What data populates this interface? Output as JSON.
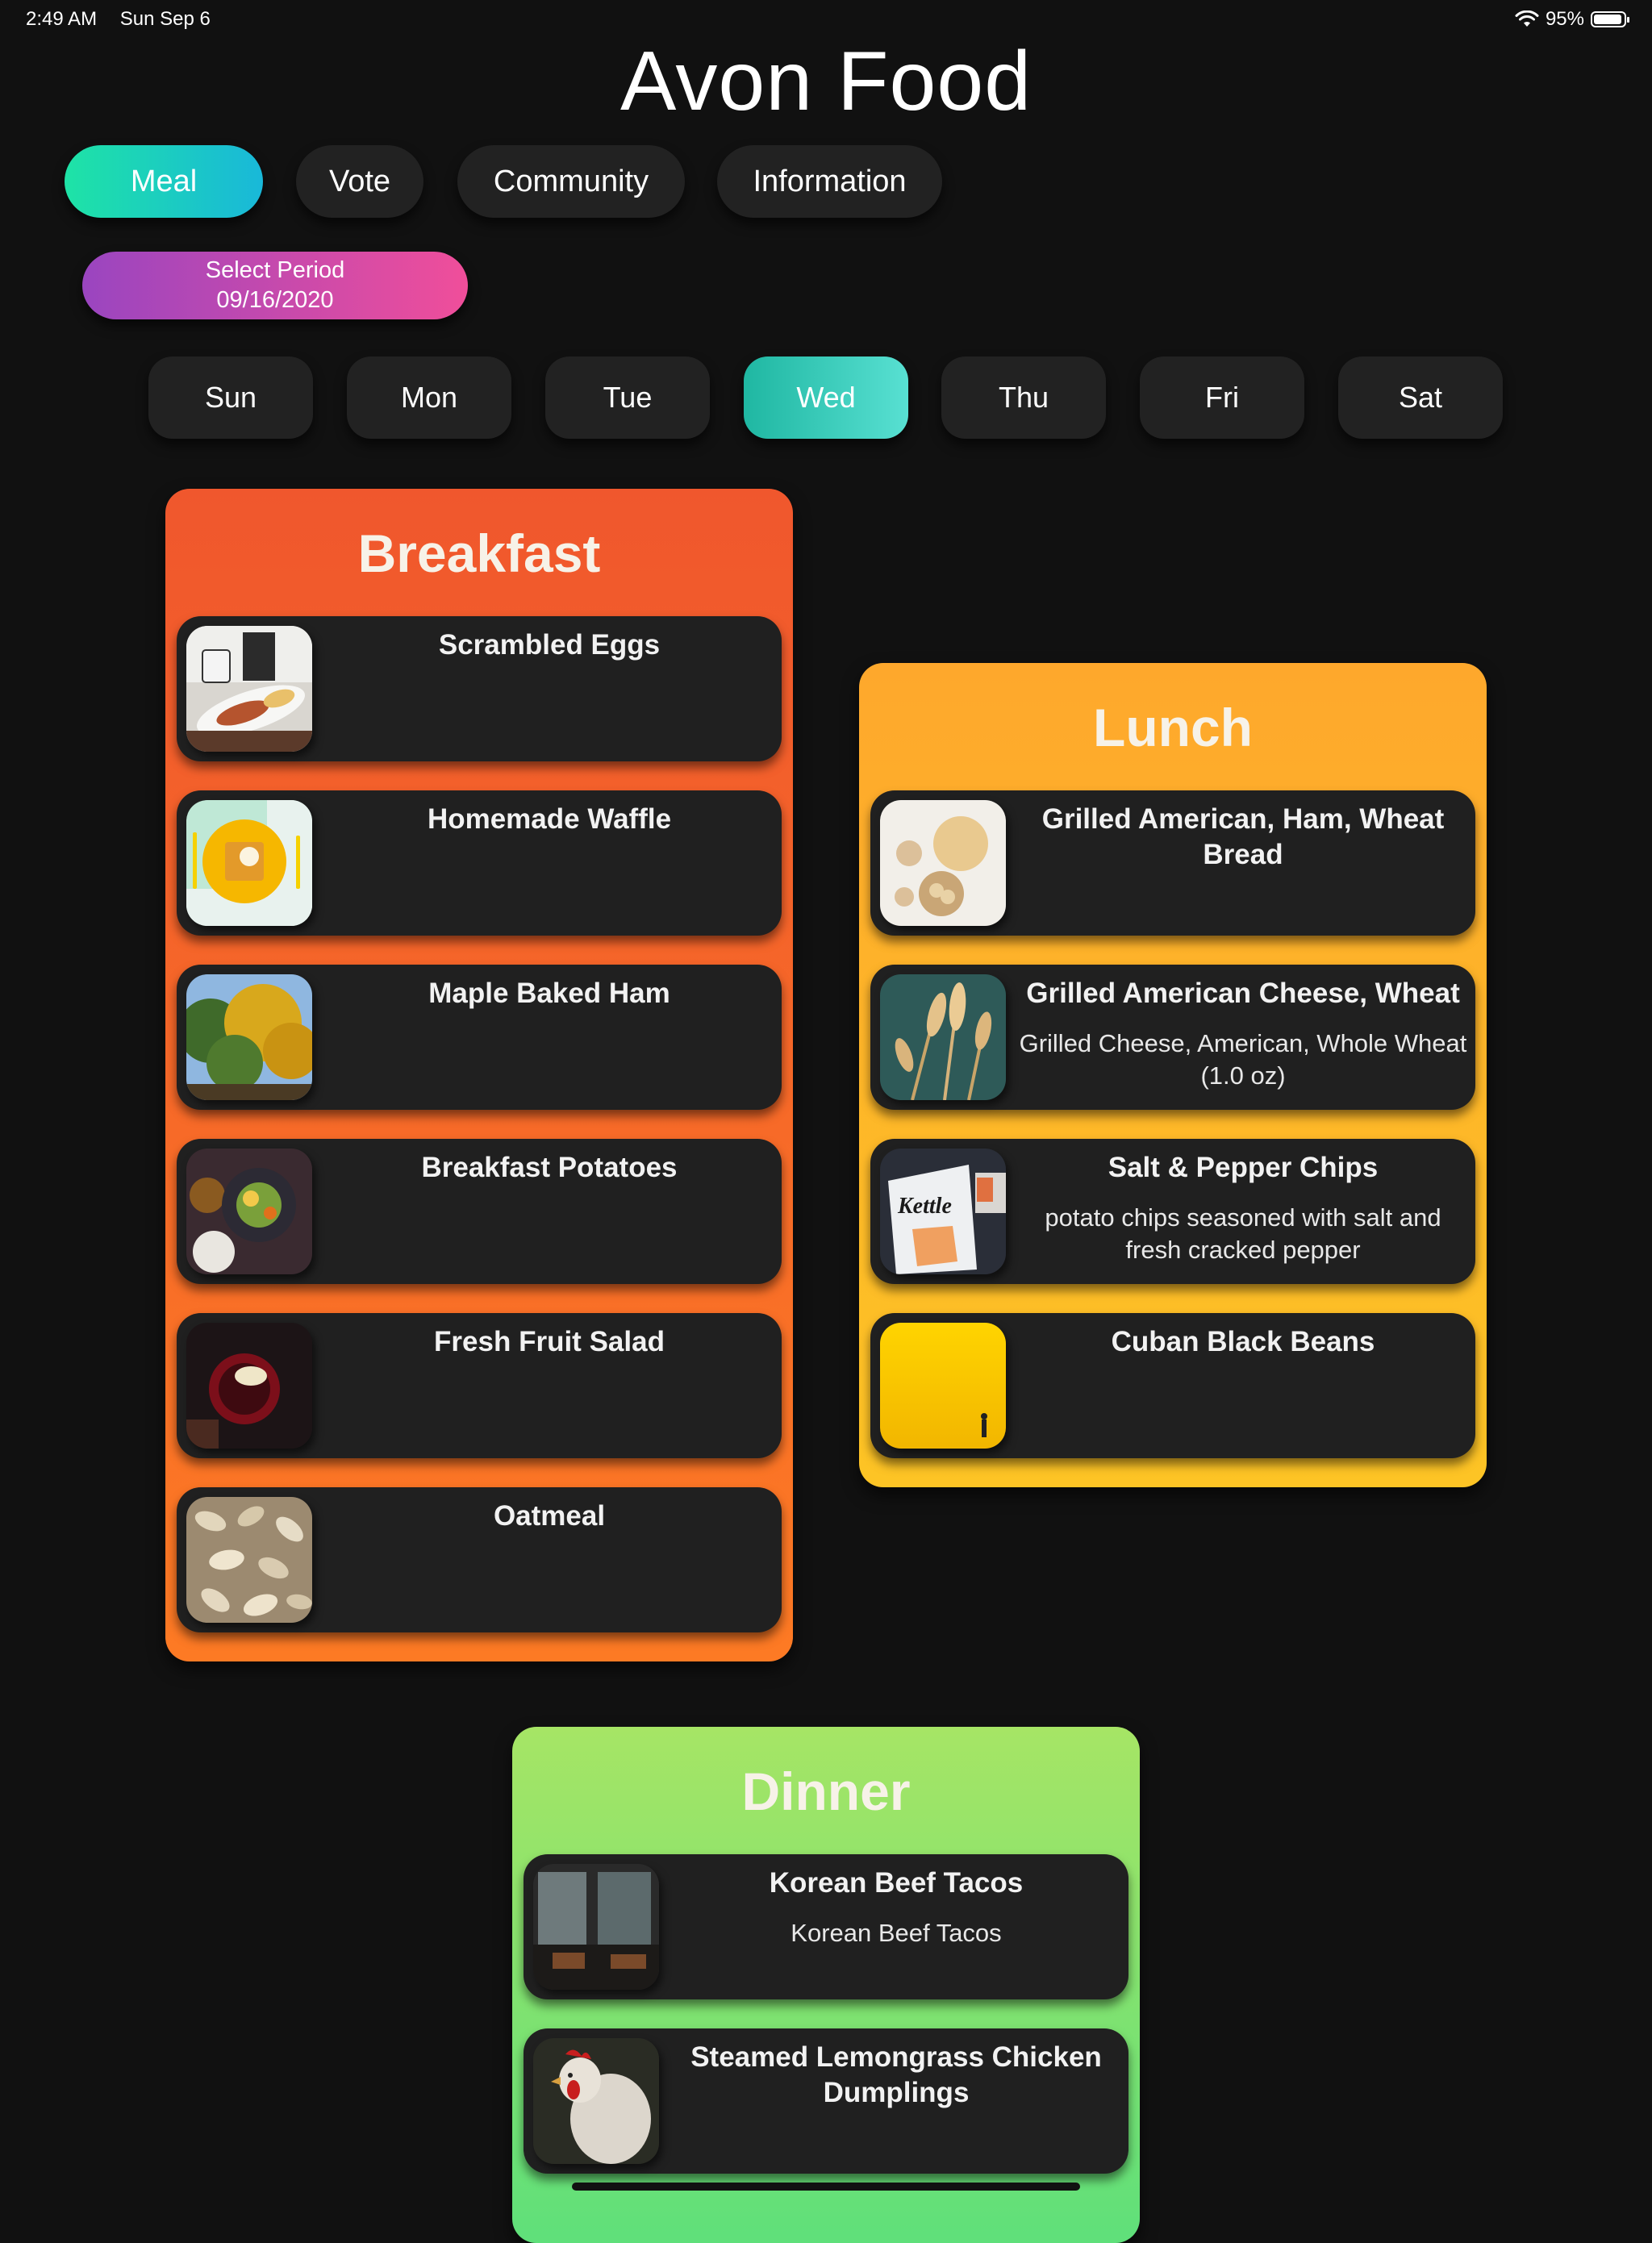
{
  "status": {
    "time": "2:49 AM",
    "date": "Sun Sep 6",
    "battery": "95%",
    "battery_level": 0.95
  },
  "app_title": "Avon Food",
  "tabs": [
    {
      "label": "Meal",
      "active": true
    },
    {
      "label": "Vote",
      "active": false
    },
    {
      "label": "Community",
      "active": false
    },
    {
      "label": "Information",
      "active": false
    }
  ],
  "period": {
    "label": "Select Period",
    "date": "09/16/2020"
  },
  "days": [
    {
      "label": "Sun",
      "active": false
    },
    {
      "label": "Mon",
      "active": false
    },
    {
      "label": "Tue",
      "active": false
    },
    {
      "label": "Wed",
      "active": true
    },
    {
      "label": "Thu",
      "active": false
    },
    {
      "label": "Fri",
      "active": false
    },
    {
      "label": "Sat",
      "active": false
    }
  ],
  "breakfast": {
    "title": "Breakfast",
    "items": [
      {
        "name": "Scrambled Eggs",
        "desc": "",
        "image": "breakfast-plate-photo"
      },
      {
        "name": "Homemade Waffle",
        "desc": "",
        "image": "waffle-plate-photo"
      },
      {
        "name": "Maple Baked Ham",
        "desc": "",
        "image": "autumn-trees-photo"
      },
      {
        "name": "Breakfast Potatoes",
        "desc": "",
        "image": "table-spread-photo"
      },
      {
        "name": "Fresh Fruit Salad",
        "desc": "",
        "image": "red-bowl-photo"
      },
      {
        "name": "Oatmeal",
        "desc": "",
        "image": "oats-photo"
      }
    ]
  },
  "lunch": {
    "title": "Lunch",
    "items": [
      {
        "name": "Grilled American, Ham, Wheat Bread",
        "desc": "",
        "image": "bread-rolls-photo"
      },
      {
        "name": "Grilled American Cheese, Wheat",
        "desc": "Grilled Cheese, American, Whole Wheat (1.0 oz)",
        "image": "wheat-photo"
      },
      {
        "name": "Salt & Pepper Chips",
        "desc": "potato chips seasoned with salt and fresh cracked pepper",
        "image": "chips-bag-photo"
      },
      {
        "name": "Cuban Black Beans",
        "desc": "",
        "image": "yellow-wall-photo"
      }
    ]
  },
  "dinner": {
    "title": "Dinner",
    "items": [
      {
        "name": "Korean Beef Tacos",
        "desc": "Korean Beef Tacos",
        "image": "restaurant-interior-photo"
      },
      {
        "name": "Steamed Lemongrass Chicken Dumplings",
        "desc": "",
        "image": "rooster-photo"
      }
    ]
  },
  "colors": {
    "background": "#111111",
    "card": "#202020",
    "meal_tab": "#1ee3a6",
    "period": "#f04e9a",
    "breakfast": "#f0572d",
    "lunch": "#fdc425",
    "dinner": "#5fe07a",
    "active_day": "#58e0d2"
  }
}
